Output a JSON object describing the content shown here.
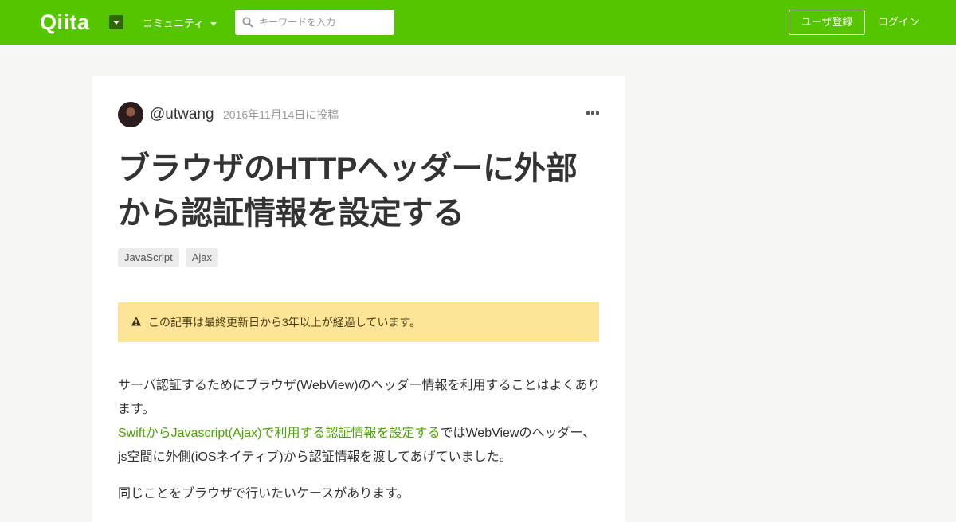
{
  "colors": {
    "brand": "#55c500",
    "background": "#f5f5f3",
    "link": "#4ba600",
    "warning_bg": "#fde598"
  },
  "header": {
    "logo": "Qiita",
    "community_label": "コミュニティ",
    "search_placeholder": "キーワードを入力",
    "signup_label": "ユーザ登録",
    "login_label": "ログイン"
  },
  "article": {
    "author": "@utwang",
    "posted_date": "2016年11月14日に投稿",
    "title": "ブラウザのHTTPヘッダーに外部から認証情報を設定する",
    "tags": [
      "JavaScript",
      "Ajax"
    ],
    "warning": "この記事は最終更新日から3年以上が経過しています。",
    "paragraph1": "サーバ認証するためにブラウザ(WebView)のヘッダー情報を利用することはよくあります。",
    "link_text": "SwiftからJavascript(Ajax)で利用する認証情報を設定する",
    "paragraph2_rest": "ではWebViewのヘッダー、js空間に外側(iOSネイティブ)から認証情報を渡してあげていました。",
    "paragraph3": "同じことをブラウザで行いたいケースがあります。"
  }
}
